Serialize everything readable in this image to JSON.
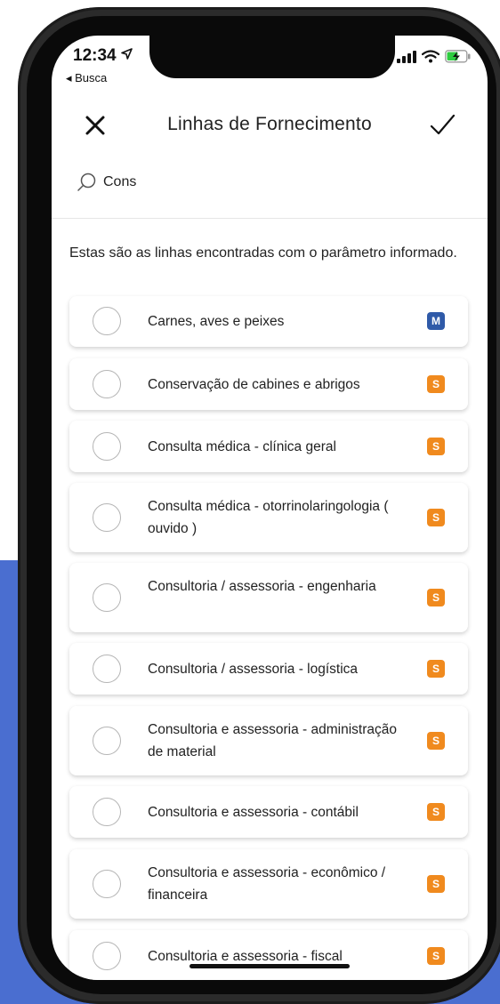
{
  "colors": {
    "background_accent": "#4a6ed0",
    "badge_m": "#2f5aa8",
    "badge_s": "#f08a1e"
  },
  "status_bar": {
    "time": "12:34",
    "back_label": "◂ Busca"
  },
  "header": {
    "title": "Linhas de Fornecimento",
    "close_icon": "close-icon",
    "confirm_icon": "checkmark-icon"
  },
  "search": {
    "icon": "search-icon",
    "value": "Cons"
  },
  "info_text": "Estas são as linhas encontradas com o parâmetro informado.",
  "items": [
    {
      "label": "Carnes, aves e peixes",
      "badge": "M"
    },
    {
      "label": "Conservação de cabines e abrigos",
      "badge": "S"
    },
    {
      "label": "Consulta médica - clínica geral",
      "badge": "S"
    },
    {
      "label": "Consulta médica - otorrinolaringologia ( ouvido )",
      "badge": "S"
    },
    {
      "label": "Consultoria / assessoria - engenharia",
      "badge": "S"
    },
    {
      "label": "Consultoria / assessoria - logística",
      "badge": "S"
    },
    {
      "label": "Consultoria e assessoria - administração de material",
      "badge": "S"
    },
    {
      "label": "Consultoria e assessoria - contábil",
      "badge": "S"
    },
    {
      "label": "Consultoria e assessoria - econômico / financeira",
      "badge": "S"
    },
    {
      "label": "Consultoria e assessoria - fiscal",
      "badge": "S"
    }
  ]
}
